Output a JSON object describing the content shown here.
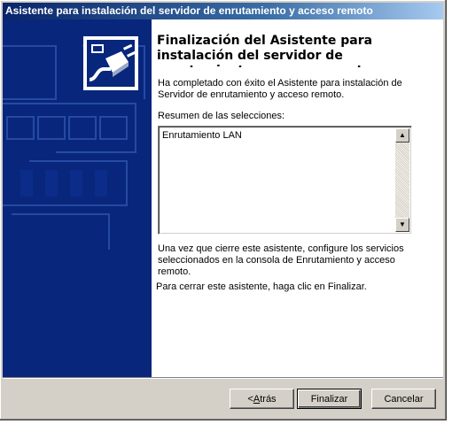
{
  "window": {
    "title": "Asistente para instalación del servidor de enrutamiento y acceso remoto"
  },
  "icons": {
    "wizard_icon": "plug-network-icon"
  },
  "content": {
    "heading": "Finalización del Asistente para instalación del servidor de enrutamiento y acceso remoto",
    "intro": "Ha completado con éxito el Asistente para instalación de Servidor de enrutamiento y acceso remoto.",
    "summary_label": "Resumen de las selecciones:",
    "summary_items": [
      "Enrutamiento LAN"
    ],
    "after_text": "Una vez que cierre este asistente, configure los servicios seleccionados en la consola de Enrutamiento y acceso remoto.",
    "close_text": "Para cerrar este asistente, haga clic en Finalizar."
  },
  "buttons": {
    "back_prefix": "< ",
    "back_accel": "A",
    "back_rest": "trás",
    "finish": "Finalizar",
    "cancel": "Cancelar"
  },
  "colors": {
    "left_panel": "#08267b",
    "title_bar": "#0a246a",
    "dialog": "#d4d0c8"
  }
}
